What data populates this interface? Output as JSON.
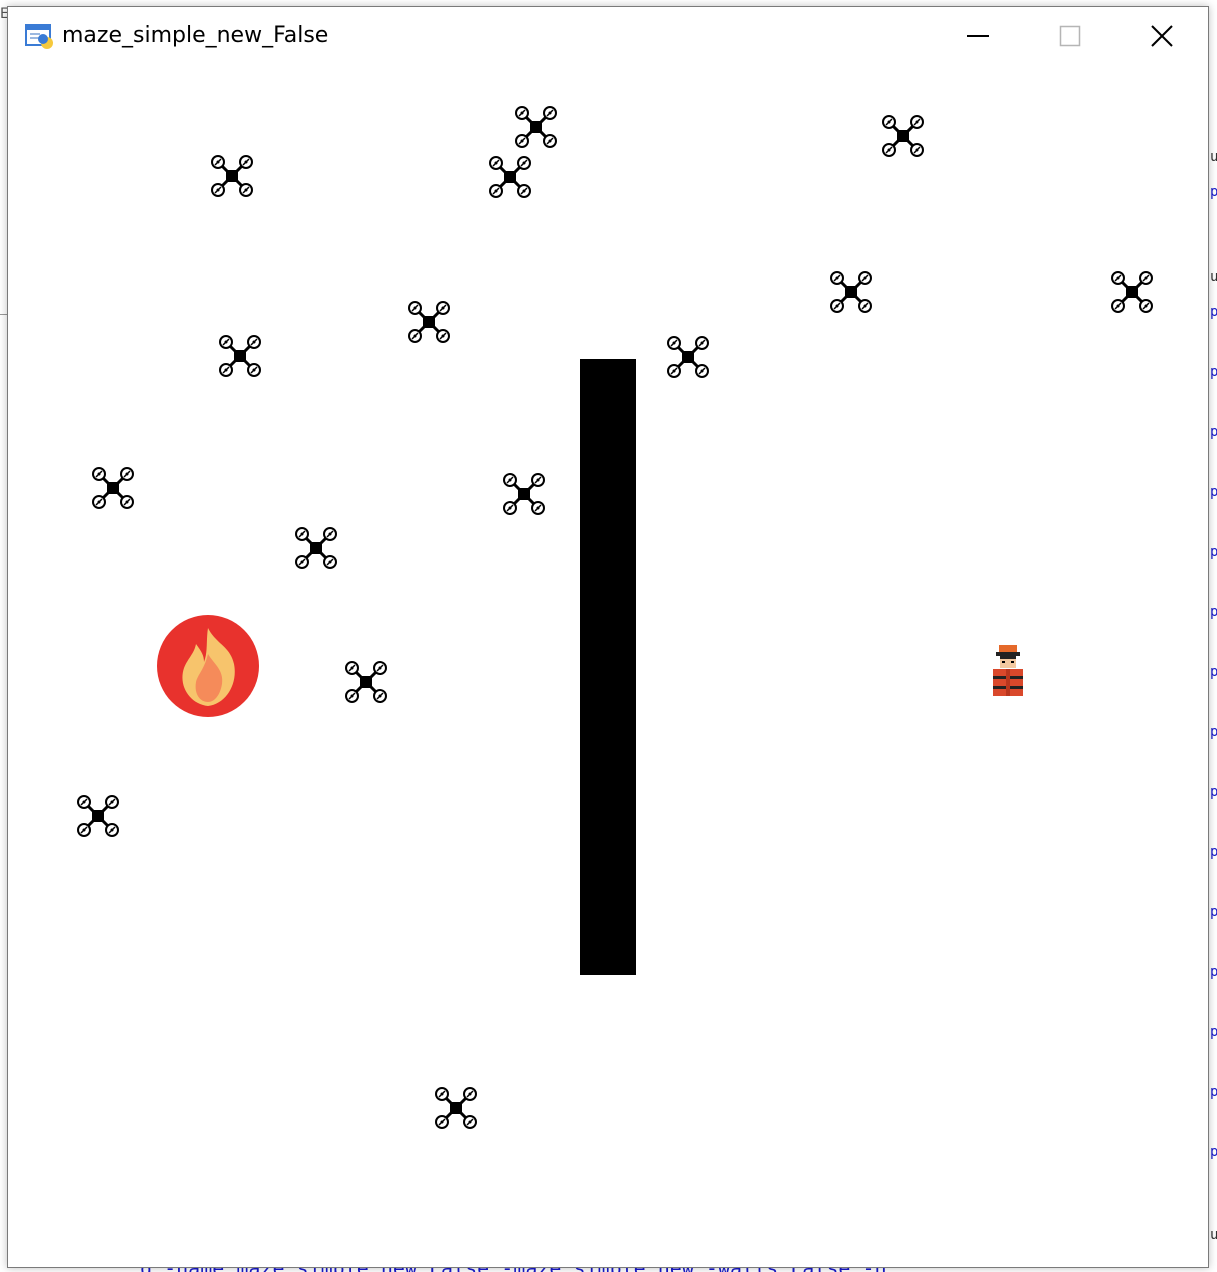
{
  "window": {
    "title": "maze_simple_new_False",
    "minimize_label": "—",
    "maximize_label": "☐",
    "close_label": "✕"
  },
  "canvas": {
    "background": "#ffffff",
    "wall_color": "#000000",
    "agent_icon": "drone-icon",
    "target_icon": "fire-icon",
    "player_icon": "firefighter-icon",
    "fire_colors": {
      "outer": "#e8322d",
      "inner": "#f7c46c",
      "core": "#f58b5a"
    }
  },
  "background_app": {
    "bottom_text": "q  -name  maze_simple_new_False  -maze  simple_new  -walls  False  -n"
  }
}
